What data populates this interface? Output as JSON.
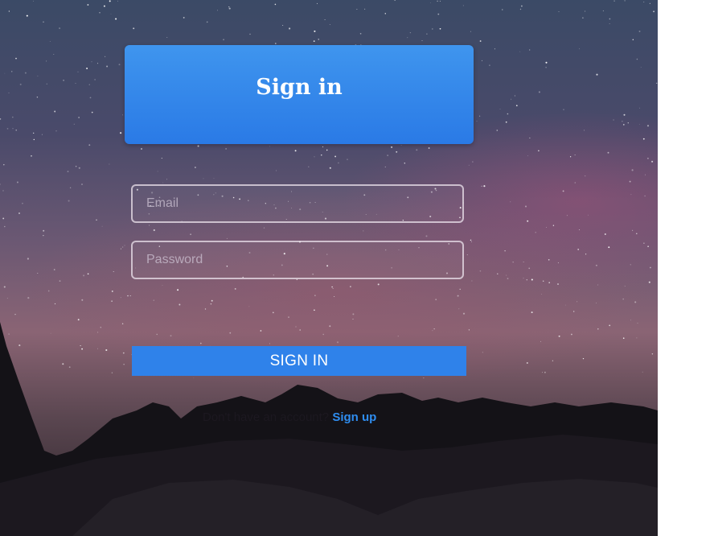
{
  "form": {
    "title": "Sign in",
    "email": {
      "placeholder": "Email",
      "value": ""
    },
    "password": {
      "placeholder": "Password",
      "value": ""
    },
    "submit_label": "SIGN IN",
    "signup_prompt": "Don't have an account?",
    "signup_link": "Sign up"
  },
  "colors": {
    "accent": "#2f82ea",
    "link": "#2f8df0",
    "white_margin": "#ffffff"
  }
}
